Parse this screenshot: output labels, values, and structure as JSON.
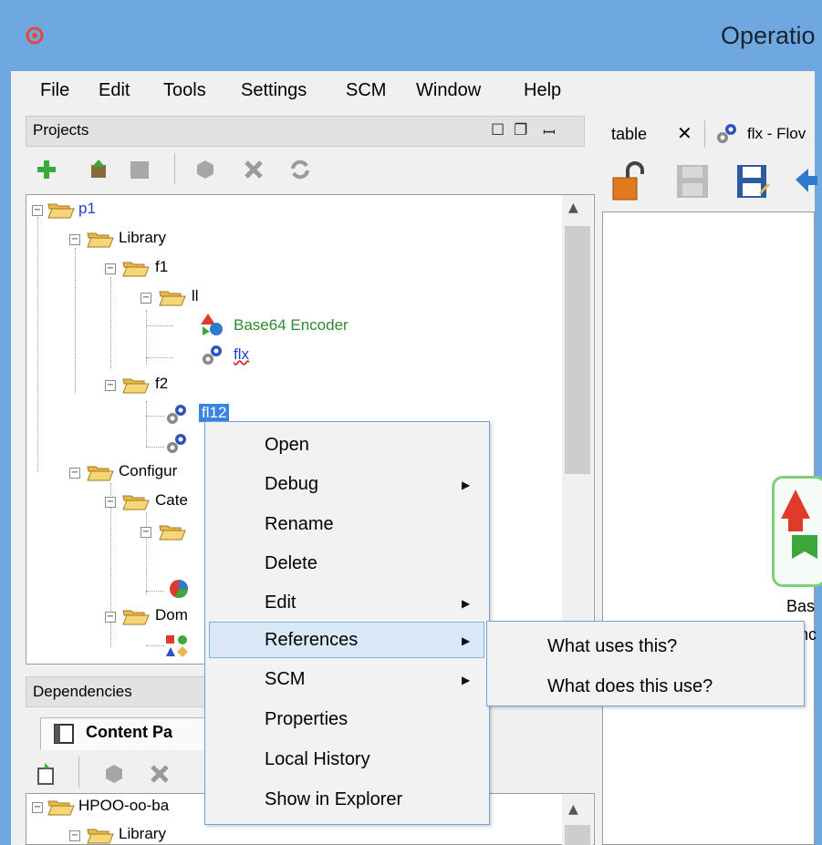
{
  "window": {
    "title": "Operatio"
  },
  "menubar": {
    "items": [
      "File",
      "Edit",
      "Tools",
      "Settings",
      "SCM",
      "Window",
      "Help"
    ]
  },
  "projects_panel": {
    "title": "Projects",
    "header_icons": [
      "maximize-icon",
      "restore-icon",
      "pin-icon"
    ],
    "toolbar_icons": [
      "add-icon",
      "import-icon",
      "package-icon",
      "disabled-gear-icon",
      "delete-icon",
      "refresh-icon"
    ]
  },
  "tree": {
    "p1": "p1",
    "library": "Library",
    "f1": "f1",
    "ll": "ll",
    "base64_encoder": "Base64 Encoder",
    "flx": "flx",
    "f2": "f2",
    "fl12": "fl12",
    "configuration": "Configur",
    "categories": "Cate",
    "domain": "Dom"
  },
  "dependencies_panel": {
    "title": "Dependencies",
    "tab_label": "Content Pa",
    "tree_root": "HPOO-oo-ba",
    "tree_library": "Library"
  },
  "editor": {
    "tab_table": "table",
    "tab_flx": "flx - Flov",
    "node_label_1": "Bas",
    "node_label_2": "nc"
  },
  "context_menu": {
    "items": [
      {
        "label": "Open",
        "submenu": false
      },
      {
        "label": "Debug",
        "submenu": true
      },
      {
        "label": "Rename",
        "submenu": false
      },
      {
        "label": "Delete",
        "submenu": false
      },
      {
        "label": "Edit",
        "submenu": true
      },
      {
        "label": "References",
        "submenu": true,
        "highlighted": true
      },
      {
        "label": "SCM",
        "submenu": true
      },
      {
        "label": "Properties",
        "submenu": false
      },
      {
        "label": "Local History",
        "submenu": false
      },
      {
        "label": "Show in Explorer",
        "submenu": false
      }
    ]
  },
  "references_submenu": {
    "items": [
      "What uses this?",
      "What does this use?"
    ]
  },
  "colors": {
    "titlebar": "#6fa8e0",
    "link_blue": "#1f3fcf",
    "link_green": "#2e8a2e",
    "selection": "#3a84e0",
    "menu_border": "#6da2d8"
  }
}
